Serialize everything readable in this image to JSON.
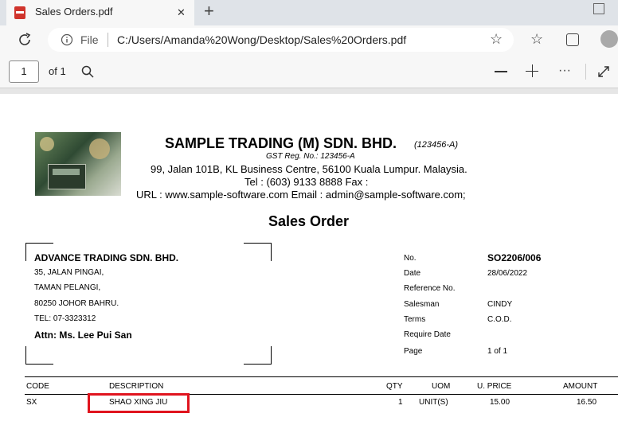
{
  "tab": {
    "title": "Sales Orders.pdf",
    "close": "✕",
    "new": "+"
  },
  "window": {
    "minimize": "—"
  },
  "address": {
    "scheme": "File",
    "path": "C:/Users/Amanda%20Wong/Desktop/Sales%20Orders.pdf"
  },
  "pdf_toolbar": {
    "page": "1",
    "of": "of 1"
  },
  "company": {
    "name": "SAMPLE TRADING (M) SDN. BHD.",
    "reg": "(123456-A)",
    "gst": "GST Reg. No.: 123456-A",
    "address": "99, Jalan 101B,  KL Business Centre, 56100 Kuala Lumpur. Malaysia.",
    "tel": "Tel : (603) 9133 8888  Fax :",
    "url": "URL : www.sample-software.com      Email : admin@sample-software.com;"
  },
  "doc_title": "Sales Order",
  "customer": {
    "name": "ADVANCE TRADING SDN. BHD.",
    "lines": [
      "35, JALAN PINGAI,",
      "TAMAN PELANGI,",
      "80250 JOHOR BAHRU.",
      "TEL: 07-3323312"
    ],
    "attn": "Attn: Ms. Lee Pui San"
  },
  "info": [
    {
      "label": "No.",
      "value": "SO2206/006"
    },
    {
      "label": "Date",
      "value": "28/06/2022"
    },
    {
      "label": "Reference No.",
      "value": ""
    },
    {
      "label": "Salesman",
      "value": "CINDY"
    },
    {
      "label": "Terms",
      "value": "C.O.D."
    },
    {
      "label": "Require Date",
      "value": ""
    },
    {
      "label": "Page",
      "value": "1 of 1"
    }
  ],
  "table": {
    "headers": {
      "code": "CODE",
      "description": "DESCRIPTION",
      "qty": "QTY",
      "uom": "UOM",
      "price": "U. PRICE",
      "amount": "AMOUNT"
    },
    "rows": [
      {
        "code": "SX",
        "description": "SHAO XING JIU",
        "qty": "1",
        "uom": "UNIT(S)",
        "price": "15.00",
        "amount": "16.50"
      }
    ]
  },
  "colors": {
    "highlight": "#e0141e",
    "pdf_icon": "#d0342c"
  }
}
